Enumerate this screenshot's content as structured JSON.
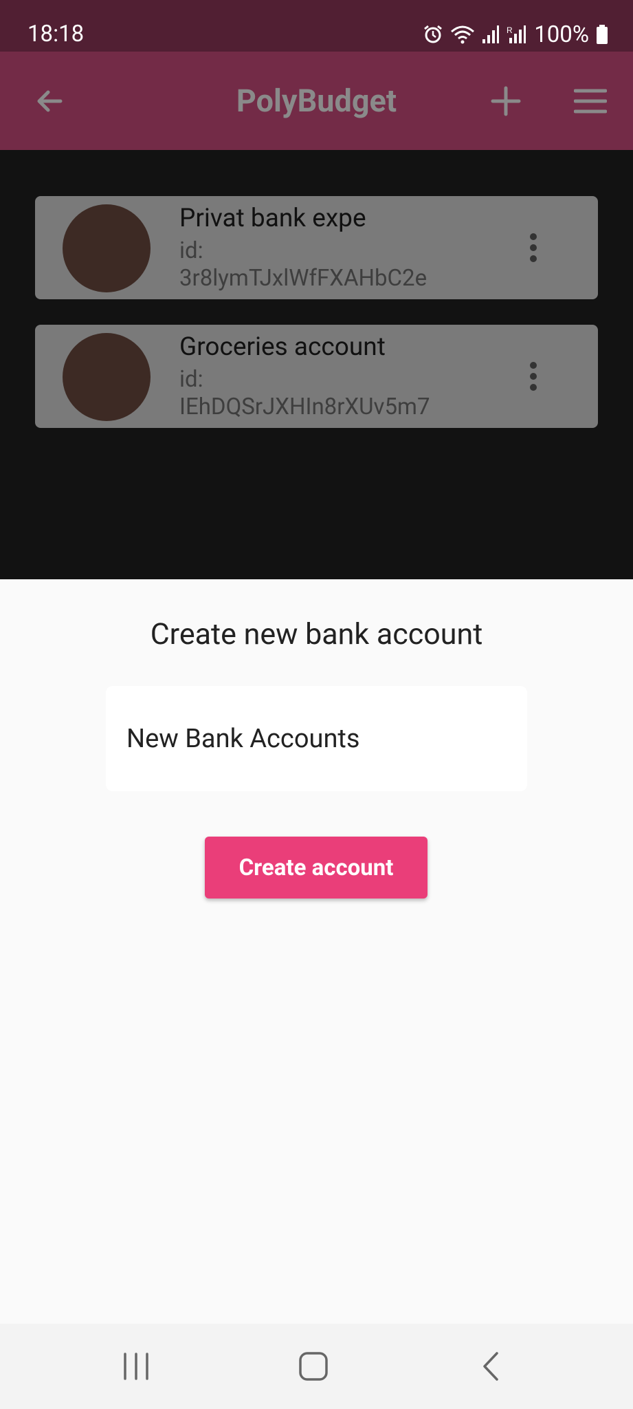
{
  "status_bar": {
    "time": "18:18",
    "battery": "100%",
    "icons": [
      "alarm-icon",
      "wifi-icon",
      "signal-icon",
      "signal-r-icon",
      "battery-icon"
    ]
  },
  "app_bar": {
    "title": "PolyBudget",
    "icons": [
      "back-arrow-icon",
      "plus-icon",
      "hamburger-menu-icon"
    ]
  },
  "accounts": [
    {
      "name": "Privat bank expe",
      "id_label": "id:",
      "id": "3r8lymTJxlWfFXAHbC2e"
    },
    {
      "name": "Groceries account",
      "id_label": "id:",
      "id": "IEhDQSrJXHIn8rXUv5m7"
    }
  ],
  "sheet": {
    "title": "Create new bank account",
    "name_value": "New Bank Accounts",
    "create_label": "Create account"
  },
  "colors": {
    "status_bar": "#511f33",
    "app_bar": "#732b47",
    "accent": "#ea3e79",
    "scrim": "#121212",
    "card": "#7a7a7a",
    "avatar": "#3d2a24"
  },
  "nav_bar": {
    "icons": [
      "recents-icon",
      "home-icon",
      "back-icon"
    ]
  }
}
